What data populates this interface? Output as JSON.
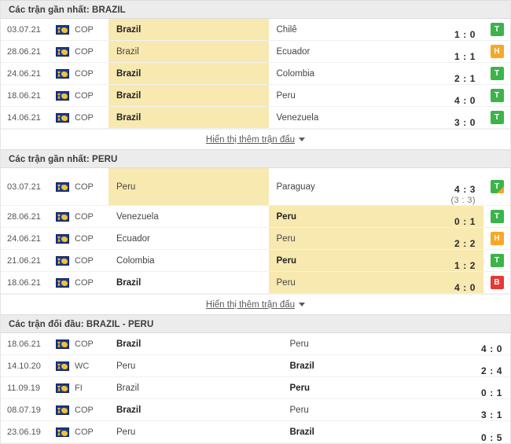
{
  "colors": {
    "highlight": "#f8e9b0",
    "header_bg": "#ececec",
    "badge_win": "#3cb44b",
    "badge_draw": "#f9a825",
    "badge_loss": "#e53935",
    "logo_blue": "#1b3a8f",
    "logo_gold": "#f2c230"
  },
  "sections": [
    {
      "id": "recent-brazil",
      "header": "Các trận gần nhất: BRAZIL",
      "show_more": "Hiển thị thêm trận đấu",
      "has_show_more": true,
      "rows": [
        {
          "date": "03.07.21",
          "logo": "competition-logo-icon",
          "comp": "COP",
          "home": "Brazil",
          "away": "Chilê",
          "score": "1 : 0",
          "pen": "",
          "badge": "T",
          "badge_type": "win",
          "badge_corner": false,
          "home_win": true,
          "away_win": false,
          "hl": "home"
        },
        {
          "date": "28.06.21",
          "logo": "competition-logo-icon",
          "comp": "COP",
          "home": "Brazil",
          "away": "Ecuador",
          "score": "1 : 1",
          "pen": "",
          "badge": "H",
          "badge_type": "draw",
          "badge_corner": false,
          "home_win": false,
          "away_win": false,
          "hl": "home"
        },
        {
          "date": "24.06.21",
          "logo": "competition-logo-icon",
          "comp": "COP",
          "home": "Brazil",
          "away": "Colombia",
          "score": "2 : 1",
          "pen": "",
          "badge": "T",
          "badge_type": "win",
          "badge_corner": false,
          "home_win": true,
          "away_win": false,
          "hl": "home"
        },
        {
          "date": "18.06.21",
          "logo": "competition-logo-icon",
          "comp": "COP",
          "home": "Brazil",
          "away": "Peru",
          "score": "4 : 0",
          "pen": "",
          "badge": "T",
          "badge_type": "win",
          "badge_corner": false,
          "home_win": true,
          "away_win": false,
          "hl": "home"
        },
        {
          "date": "14.06.21",
          "logo": "competition-logo-icon",
          "comp": "COP",
          "home": "Brazil",
          "away": "Venezuela",
          "score": "3 : 0",
          "pen": "",
          "badge": "T",
          "badge_type": "win",
          "badge_corner": false,
          "home_win": true,
          "away_win": false,
          "hl": "home"
        }
      ]
    },
    {
      "id": "recent-peru",
      "header": "Các trận gần nhất: PERU",
      "show_more": "Hiển thị thêm trận đấu",
      "has_show_more": true,
      "rows": [
        {
          "date": "03.07.21",
          "logo": "competition-logo-icon",
          "comp": "COP",
          "home": "Peru",
          "away": "Paraguay",
          "score": "4 : 3",
          "pen": "(3 : 3)",
          "badge": "T",
          "badge_type": "win",
          "badge_corner": true,
          "home_win": false,
          "away_win": false,
          "hl": "home",
          "tall": true
        },
        {
          "date": "28.06.21",
          "logo": "competition-logo-icon",
          "comp": "COP",
          "home": "Venezuela",
          "away": "Peru",
          "score": "0 : 1",
          "pen": "",
          "badge": "T",
          "badge_type": "win",
          "badge_corner": false,
          "home_win": false,
          "away_win": true,
          "hl": "away"
        },
        {
          "date": "24.06.21",
          "logo": "competition-logo-icon",
          "comp": "COP",
          "home": "Ecuador",
          "away": "Peru",
          "score": "2 : 2",
          "pen": "",
          "badge": "H",
          "badge_type": "draw",
          "badge_corner": false,
          "home_win": false,
          "away_win": false,
          "hl": "away"
        },
        {
          "date": "21.06.21",
          "logo": "competition-logo-icon",
          "comp": "COP",
          "home": "Colombia",
          "away": "Peru",
          "score": "1 : 2",
          "pen": "",
          "badge": "T",
          "badge_type": "win",
          "badge_corner": false,
          "home_win": false,
          "away_win": true,
          "hl": "away"
        },
        {
          "date": "18.06.21",
          "logo": "competition-logo-icon",
          "comp": "COP",
          "home": "Brazil",
          "away": "Peru",
          "score": "4 : 0",
          "pen": "",
          "badge": "B",
          "badge_type": "loss",
          "badge_corner": false,
          "home_win": true,
          "away_win": false,
          "hl": "away"
        }
      ]
    },
    {
      "id": "head-to-head",
      "header": "Các trận đối đầu: BRAZIL - PERU",
      "show_more": "",
      "has_show_more": false,
      "rows": [
        {
          "date": "18.06.21",
          "logo": "competition-logo-icon",
          "comp": "COP",
          "home": "Brazil",
          "away": "Peru",
          "score": "4 : 0",
          "pen": "",
          "badge": "",
          "badge_type": "",
          "badge_corner": false,
          "home_win": true,
          "away_win": false,
          "hl": "none"
        },
        {
          "date": "14.10.20",
          "logo": "competition-logo-icon",
          "comp": "WC",
          "home": "Peru",
          "away": "Brazil",
          "score": "2 : 4",
          "pen": "",
          "badge": "",
          "badge_type": "",
          "badge_corner": false,
          "home_win": false,
          "away_win": true,
          "hl": "none"
        },
        {
          "date": "11.09.19",
          "logo": "competition-logo-icon",
          "comp": "FI",
          "home": "Brazil",
          "away": "Peru",
          "score": "0 : 1",
          "pen": "",
          "badge": "",
          "badge_type": "",
          "badge_corner": false,
          "home_win": false,
          "away_win": true,
          "hl": "none"
        },
        {
          "date": "08.07.19",
          "logo": "competition-logo-icon",
          "comp": "COP",
          "home": "Brazil",
          "away": "Peru",
          "score": "3 : 1",
          "pen": "",
          "badge": "",
          "badge_type": "",
          "badge_corner": false,
          "home_win": true,
          "away_win": false,
          "hl": "none"
        },
        {
          "date": "23.06.19",
          "logo": "competition-logo-icon",
          "comp": "COP",
          "home": "Peru",
          "away": "Brazil",
          "score": "0 : 5",
          "pen": "",
          "badge": "",
          "badge_type": "",
          "badge_corner": false,
          "home_win": false,
          "away_win": true,
          "hl": "none"
        }
      ]
    }
  ]
}
